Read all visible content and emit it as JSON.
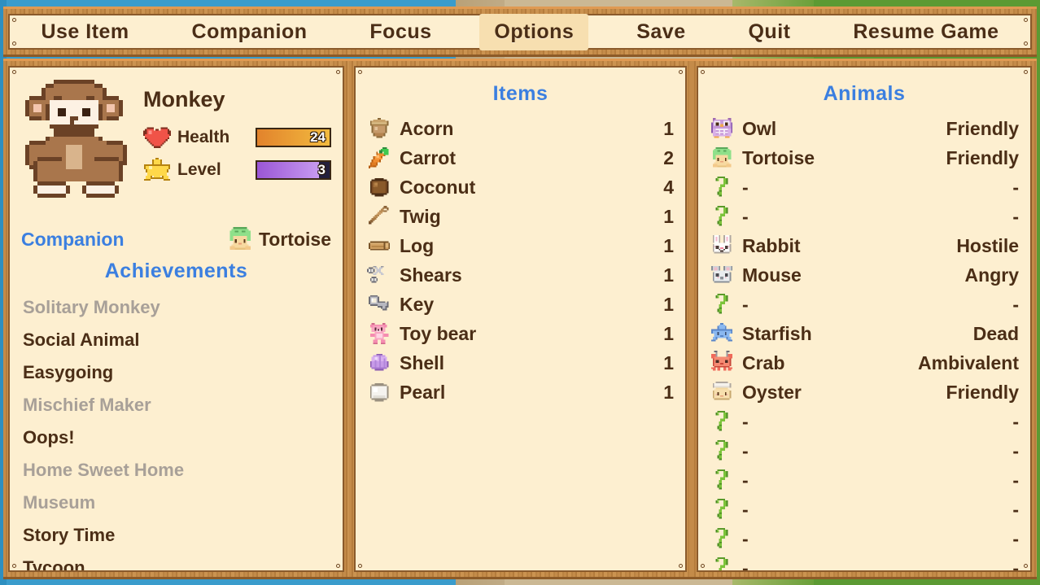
{
  "menubar": {
    "items": [
      {
        "label": "Use Item",
        "active": false
      },
      {
        "label": "Companion",
        "active": false
      },
      {
        "label": "Focus",
        "active": false
      },
      {
        "label": "Options",
        "active": true
      },
      {
        "label": "Save",
        "active": false
      },
      {
        "label": "Quit",
        "active": false
      },
      {
        "label": "Resume Game",
        "active": false
      }
    ]
  },
  "character": {
    "name": "Monkey",
    "avatar_icon": "monkey-icon",
    "health": {
      "label": "Health",
      "icon": "heart-icon",
      "value": "24",
      "percent": 100,
      "color": "#f2bb3f"
    },
    "level": {
      "label": "Level",
      "icon": "star-icon",
      "value": "3",
      "percent": 85,
      "color": "#9a56d6"
    }
  },
  "companion": {
    "label": "Companion",
    "name": "Tortoise",
    "icon": "tortoise-icon"
  },
  "achievements": {
    "title": "Achievements",
    "items": [
      {
        "label": "Solitary Monkey",
        "unlocked": false
      },
      {
        "label": "Social Animal",
        "unlocked": true
      },
      {
        "label": "Easygoing",
        "unlocked": true
      },
      {
        "label": "Mischief Maker",
        "unlocked": false
      },
      {
        "label": "Oops!",
        "unlocked": true
      },
      {
        "label": "Home Sweet Home",
        "unlocked": false
      },
      {
        "label": "Museum",
        "unlocked": false
      },
      {
        "label": "Story Time",
        "unlocked": true
      },
      {
        "label": "Tycoon",
        "unlocked": true
      }
    ]
  },
  "items": {
    "title": "Items",
    "rows": [
      {
        "name": "Acorn",
        "icon": "acorn-icon",
        "count": "1"
      },
      {
        "name": "Carrot",
        "icon": "carrot-icon",
        "count": "2"
      },
      {
        "name": "Coconut",
        "icon": "coconut-icon",
        "count": "4"
      },
      {
        "name": "Twig",
        "icon": "twig-icon",
        "count": "1"
      },
      {
        "name": "Log",
        "icon": "log-icon",
        "count": "1"
      },
      {
        "name": "Shears",
        "icon": "shears-icon",
        "count": "1"
      },
      {
        "name": "Key",
        "icon": "key-icon",
        "count": "1"
      },
      {
        "name": "Toy bear",
        "icon": "toybear-icon",
        "count": "1"
      },
      {
        "name": "Shell",
        "icon": "shell-icon",
        "count": "1"
      },
      {
        "name": "Pearl",
        "icon": "pearl-icon",
        "count": "1"
      }
    ]
  },
  "animals": {
    "title": "Animals",
    "rows": [
      {
        "name": "Owl",
        "icon": "owl-icon",
        "mood": "Friendly"
      },
      {
        "name": "Tortoise",
        "icon": "tortoise-icon",
        "mood": "Friendly"
      },
      {
        "name": "-",
        "icon": "unknown-icon",
        "mood": "-"
      },
      {
        "name": "-",
        "icon": "unknown-icon",
        "mood": "-"
      },
      {
        "name": "Rabbit",
        "icon": "rabbit-icon",
        "mood": "Hostile"
      },
      {
        "name": "Mouse",
        "icon": "mouse-icon",
        "mood": "Angry"
      },
      {
        "name": "-",
        "icon": "unknown-icon",
        "mood": "-"
      },
      {
        "name": "Starfish",
        "icon": "starfish-icon",
        "mood": "Dead"
      },
      {
        "name": "Crab",
        "icon": "crab-icon",
        "mood": "Ambivalent"
      },
      {
        "name": "Oyster",
        "icon": "oyster-icon",
        "mood": "Friendly"
      },
      {
        "name": "-",
        "icon": "unknown-icon",
        "mood": "-"
      },
      {
        "name": "-",
        "icon": "unknown-icon",
        "mood": "-"
      },
      {
        "name": "-",
        "icon": "unknown-icon",
        "mood": "-"
      },
      {
        "name": "-",
        "icon": "unknown-icon",
        "mood": "-"
      },
      {
        "name": "-",
        "icon": "unknown-icon",
        "mood": "-"
      },
      {
        "name": "-",
        "icon": "unknown-icon",
        "mood": "-"
      }
    ]
  },
  "colors": {
    "accent_blue": "#3b7fe0",
    "text_brown": "#4b2e16",
    "locked_gray": "#a8a098",
    "panel_cream": "#fdefd0",
    "wood": "#c48b49"
  }
}
